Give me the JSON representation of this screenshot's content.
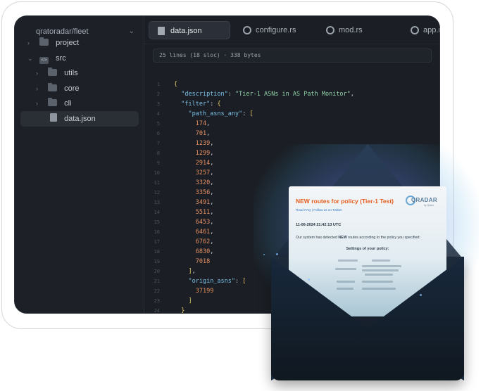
{
  "sidebar": {
    "repo": "qratoradar/fleet",
    "items": [
      {
        "label": "project",
        "icon": "folder-icon"
      },
      {
        "label": "src",
        "icon": "code-folder-icon"
      },
      {
        "label": "utils",
        "icon": "folder-icon"
      },
      {
        "label": "core",
        "icon": "folder-icon"
      },
      {
        "label": "cli",
        "icon": "folder-icon"
      },
      {
        "label": "data.json",
        "icon": "json-file-icon"
      }
    ]
  },
  "tabs": [
    {
      "label": "data.json",
      "icon": "json-file-icon"
    },
    {
      "label": "configure.rs",
      "icon": "rust-icon"
    },
    {
      "label": "mod.rs",
      "icon": "rust-icon"
    },
    {
      "label": "app.r",
      "icon": "rust-icon"
    }
  ],
  "editor": {
    "file_info": "25 lines (18 sloc) · 338 bytes",
    "line_numbers": [
      "1",
      "2",
      "3",
      "4",
      "5",
      "6",
      "7",
      "8",
      "9",
      "10",
      "11",
      "12",
      "13",
      "14",
      "15",
      "16",
      "17",
      "18",
      "19",
      "20",
      "21",
      "22",
      "23",
      "24",
      "25"
    ],
    "lines": [
      "{",
      "  \"description\": \"Tier-1 ASNs in AS Path Monitor\",",
      "  \"filter\": {",
      "    \"path_asns_any\": [",
      "      174,",
      "      701,",
      "      1239,",
      "      1299,",
      "      2914,",
      "      3257,",
      "      3320,",
      "      3356,",
      "      3491,",
      "      5511,",
      "      6453,",
      "      6461,",
      "      6762,",
      "      6830,",
      "      7018",
      "    ],",
      "    \"origin_asns\": [",
      "      37199",
      "    ]",
      "  }",
      "}"
    ]
  },
  "email": {
    "title": "NEW routes for policy (Tier-1 Test)",
    "links": "Read FAQ | Follow us on Twitter",
    "date": "11-06-2024 21:42:13 UTC",
    "message_prefix": "Our system has detected ",
    "message_bold": "NEW",
    "message_suffix": " routes according to the policy you specified:",
    "settings_heading": "Settings of your policy:",
    "logo_text": "QRADAR",
    "logo_sub": "by Qrator"
  },
  "colors": {
    "accent_orange": "#e55d1e",
    "key_blue": "#7bc0e6",
    "string_green": "#8fd1a7",
    "number_orange": "#e58f62",
    "punct_yellow": "#e8c96b"
  }
}
